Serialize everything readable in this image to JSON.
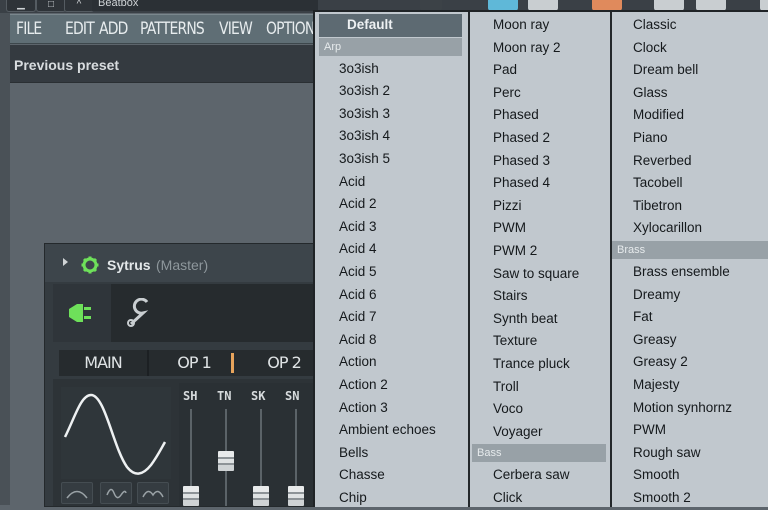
{
  "window": {
    "title": "Beatbox",
    "buttons": [
      "minimize",
      "restore",
      "close"
    ]
  },
  "menubar": {
    "items": [
      "FILE",
      "EDIT",
      "ADD",
      "PATTERNS",
      "VIEW",
      "OPTION"
    ]
  },
  "hint_bar": {
    "text": "Previous preset"
  },
  "sytrus": {
    "title": "Sytrus",
    "subtitle": "(Master)",
    "tabs": [
      "MAIN",
      "OP 1",
      "OP 2"
    ],
    "fader_labels": [
      "SH",
      "TN",
      "SK",
      "SN"
    ],
    "fader_values": [
      0.0,
      0.6,
      0.0,
      0.0
    ],
    "accent_color": "#6ee05a"
  },
  "preset_menu": {
    "columns": [
      {
        "items": [
          {
            "type": "default",
            "label": "Default"
          },
          {
            "type": "header",
            "label": "Arp"
          },
          {
            "type": "item",
            "label": "3o3ish"
          },
          {
            "type": "item",
            "label": "3o3ish 2"
          },
          {
            "type": "item",
            "label": "3o3ish 3"
          },
          {
            "type": "item",
            "label": "3o3ish 4"
          },
          {
            "type": "item",
            "label": "3o3ish 5"
          },
          {
            "type": "item",
            "label": "Acid"
          },
          {
            "type": "item",
            "label": "Acid 2"
          },
          {
            "type": "item",
            "label": "Acid 3"
          },
          {
            "type": "item",
            "label": "Acid 4"
          },
          {
            "type": "item",
            "label": "Acid 5"
          },
          {
            "type": "item",
            "label": "Acid 6"
          },
          {
            "type": "item",
            "label": "Acid 7"
          },
          {
            "type": "item",
            "label": "Acid 8"
          },
          {
            "type": "item",
            "label": "Action"
          },
          {
            "type": "item",
            "label": "Action 2"
          },
          {
            "type": "item",
            "label": "Action 3"
          },
          {
            "type": "item",
            "label": "Ambient echoes"
          },
          {
            "type": "item",
            "label": "Bells"
          },
          {
            "type": "item",
            "label": "Chasse"
          },
          {
            "type": "item",
            "label": "Chip"
          }
        ]
      },
      {
        "items": [
          {
            "type": "item",
            "label": "Moon ray"
          },
          {
            "type": "item",
            "label": "Moon ray 2"
          },
          {
            "type": "item",
            "label": "Pad"
          },
          {
            "type": "item",
            "label": "Perc"
          },
          {
            "type": "item",
            "label": "Phased"
          },
          {
            "type": "item",
            "label": "Phased 2"
          },
          {
            "type": "item",
            "label": "Phased 3"
          },
          {
            "type": "item",
            "label": "Phased 4"
          },
          {
            "type": "item",
            "label": "Pizzi"
          },
          {
            "type": "item",
            "label": "PWM"
          },
          {
            "type": "item",
            "label": "PWM 2"
          },
          {
            "type": "item",
            "label": "Saw to square"
          },
          {
            "type": "item",
            "label": "Stairs"
          },
          {
            "type": "item",
            "label": "Synth beat"
          },
          {
            "type": "item",
            "label": "Texture"
          },
          {
            "type": "item",
            "label": "Trance pluck"
          },
          {
            "type": "item",
            "label": "Troll"
          },
          {
            "type": "item",
            "label": "Voco"
          },
          {
            "type": "item",
            "label": "Voyager"
          },
          {
            "type": "header",
            "label": "Bass"
          },
          {
            "type": "item",
            "label": "Cerbera saw"
          },
          {
            "type": "item",
            "label": "Click"
          }
        ]
      },
      {
        "items": [
          {
            "type": "item",
            "label": "Classic"
          },
          {
            "type": "item",
            "label": "Clock"
          },
          {
            "type": "item",
            "label": "Dream bell"
          },
          {
            "type": "item",
            "label": "Glass"
          },
          {
            "type": "item",
            "label": "Modified"
          },
          {
            "type": "item",
            "label": "Piano"
          },
          {
            "type": "item",
            "label": "Reverbed"
          },
          {
            "type": "item",
            "label": "Tacobell"
          },
          {
            "type": "item",
            "label": "Tibetron"
          },
          {
            "type": "item",
            "label": "Xylocarillon"
          },
          {
            "type": "header",
            "label": "Brass"
          },
          {
            "type": "item",
            "label": "Brass ensemble"
          },
          {
            "type": "item",
            "label": "Dreamy"
          },
          {
            "type": "item",
            "label": "Fat"
          },
          {
            "type": "item",
            "label": "Greasy"
          },
          {
            "type": "item",
            "label": "Greasy 2"
          },
          {
            "type": "item",
            "label": "Majesty"
          },
          {
            "type": "item",
            "label": "Motion synhornz"
          },
          {
            "type": "item",
            "label": "PWM"
          },
          {
            "type": "item",
            "label": "Rough saw"
          },
          {
            "type": "item",
            "label": "Smooth"
          },
          {
            "type": "item",
            "label": "Smooth 2"
          }
        ]
      }
    ]
  }
}
